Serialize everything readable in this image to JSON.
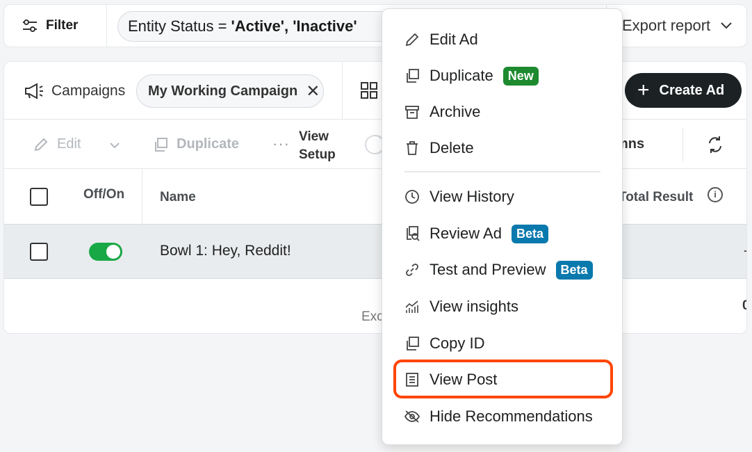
{
  "filterbar": {
    "filter_label": "Filter",
    "status_filter": {
      "prefix": "Entity Status =",
      "values": "'Active', 'Inactive'"
    },
    "export_label": "Export report"
  },
  "header": {
    "campaigns_label": "Campaigns",
    "campaign_chip": "My Working Campaign",
    "create_ad_label": "Create Ad"
  },
  "toolbar": {
    "edit_label": "Edit",
    "duplicate_label": "Duplicate",
    "view_setup_line1": "View",
    "view_setup_line2": "Setup",
    "columns_partial": "mns"
  },
  "table": {
    "columns": {
      "off_on": "Off/On",
      "name": "Name",
      "total_result": "Total Result"
    },
    "rows": [
      {
        "name": "Bowl 1: Hey, Reddit!",
        "total_result": "-",
        "enabled": true
      }
    ],
    "footer_partial": "Exc",
    "footer_total": "0"
  },
  "context_menu": {
    "items": [
      {
        "label": "Edit Ad",
        "icon": "pencil-icon"
      },
      {
        "label": "Duplicate",
        "icon": "duplicate-icon",
        "badge": "New"
      },
      {
        "label": "Archive",
        "icon": "archive-icon"
      },
      {
        "label": "Delete",
        "icon": "trash-icon"
      },
      {
        "label": "View History",
        "icon": "clock-icon"
      },
      {
        "label": "Review Ad",
        "icon": "review-icon",
        "badge": "Beta"
      },
      {
        "label": "Test and Preview",
        "icon": "link-icon",
        "badge": "Beta"
      },
      {
        "label": "View insights",
        "icon": "insights-icon"
      },
      {
        "label": "Copy ID",
        "icon": "copy-icon"
      },
      {
        "label": "View Post",
        "icon": "post-icon",
        "highlighted": true
      },
      {
        "label": "Hide Recommendations",
        "icon": "eye-off-icon"
      }
    ]
  },
  "colors": {
    "highlight": "#ff4500",
    "badge_new": "#1d8a2f",
    "badge_beta": "#0a79ad",
    "toggle_on": "#18a845",
    "create_button": "#1c2224"
  }
}
